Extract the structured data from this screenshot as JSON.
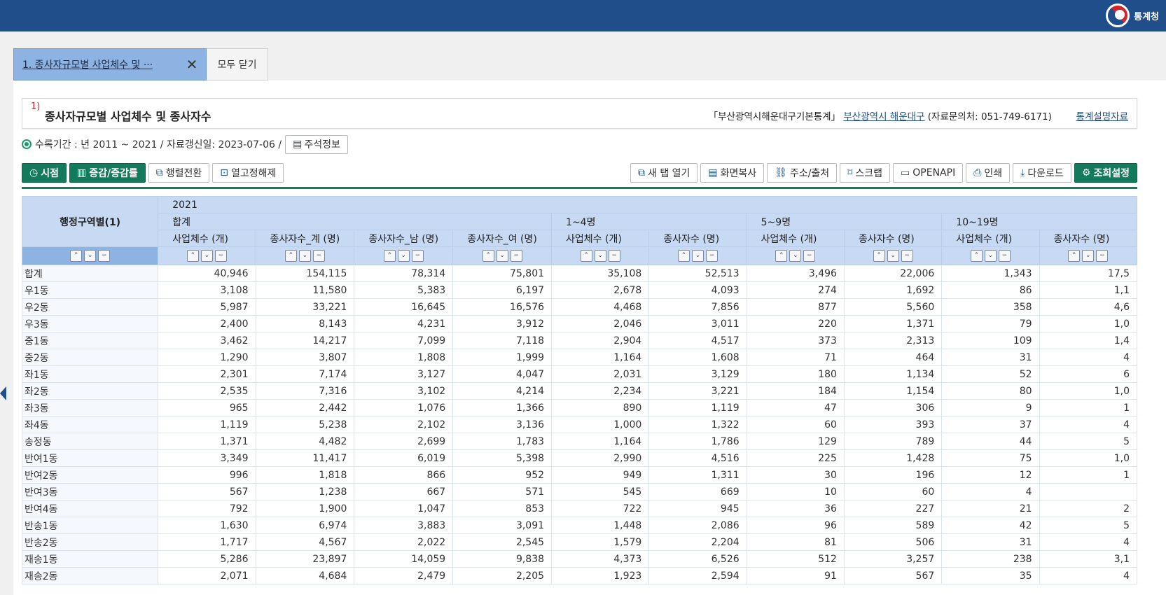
{
  "header": {
    "logo_text": "통계청",
    "colors": {
      "topbar": "#1f4e8a",
      "accent_green": "#137a5c",
      "tab_active": "#8db3e2"
    }
  },
  "tabs": {
    "active_label": "1. 종사자규모별 사업체수 및 ···",
    "close_icon": "close-icon",
    "close_all_label": "모두 닫기"
  },
  "title": {
    "footnote": "1)",
    "text": "종사자규모별 사업체수 및 종사자수",
    "source_label": "「부산광역시해운대구기본통계」",
    "agency_link": "부산광역시 해운대구",
    "contact": "(자료문의처: 051-749-6171)",
    "stat_info_link": "통계설명자료"
  },
  "info": {
    "text": "수록기간 : 년 2011 ~ 2021 / 자료갱신일: 2023-07-06 /",
    "note_button": "주석정보"
  },
  "toolbar": {
    "left": [
      {
        "label": "시점",
        "icon": "clock-icon",
        "glyph": "◷",
        "style": "green"
      },
      {
        "label": "증감/증감률",
        "icon": "bar-chart-icon",
        "glyph": "▥",
        "style": "green"
      },
      {
        "label": "행렬전환",
        "icon": "swap-icon",
        "glyph": "⧉",
        "style": "normal"
      },
      {
        "label": "열고정해제",
        "icon": "unlock-columns-icon",
        "glyph": "⊡",
        "style": "normal"
      }
    ],
    "right": [
      {
        "label": "새 탭 열기",
        "icon": "new-tab-icon",
        "glyph": "⧉",
        "style": "normal"
      },
      {
        "label": "화면복사",
        "icon": "copy-icon",
        "glyph": "▤",
        "style": "normal"
      },
      {
        "label": "주소/출처",
        "icon": "link-icon",
        "glyph": "⛓",
        "style": "normal"
      },
      {
        "label": "스크랩",
        "icon": "bookmark-icon",
        "glyph": "⌑",
        "style": "normal"
      },
      {
        "label": "OPENAPI",
        "icon": "api-icon",
        "glyph": "▭",
        "style": "normal"
      },
      {
        "label": "인쇄",
        "icon": "print-icon",
        "glyph": "⎙",
        "style": "normal"
      },
      {
        "label": "다운로드",
        "icon": "download-icon",
        "glyph": "⤓",
        "style": "normal"
      },
      {
        "label": "조회설정",
        "icon": "gear-icon",
        "glyph": "⚙",
        "style": "green"
      }
    ]
  },
  "table": {
    "row_header": "행정구역별(1)",
    "year": "2021",
    "groups": [
      {
        "label": "합계",
        "span": 4
      },
      {
        "label": "1~4명",
        "span": 2
      },
      {
        "label": "5~9명",
        "span": 2
      },
      {
        "label": "10~19명",
        "span": 2
      }
    ],
    "columns": [
      "사업체수 (개)",
      "종사자수_계 (명)",
      "종사자수_남 (명)",
      "종사자수_여 (명)",
      "사업체수 (개)",
      "종사자수 (명)",
      "사업체수 (개)",
      "종사자수 (명)",
      "사업체수 (개)",
      "종사자수 (명)"
    ],
    "rows": [
      {
        "name": "합계",
        "values": [
          "40,946",
          "154,115",
          "78,314",
          "75,801",
          "35,108",
          "52,513",
          "3,496",
          "22,006",
          "1,343",
          "17,5"
        ]
      },
      {
        "name": "우1동",
        "values": [
          "3,108",
          "11,580",
          "5,383",
          "6,197",
          "2,678",
          "4,093",
          "274",
          "1,692",
          "86",
          "1,1"
        ]
      },
      {
        "name": "우2동",
        "values": [
          "5,987",
          "33,221",
          "16,645",
          "16,576",
          "4,468",
          "7,856",
          "877",
          "5,560",
          "358",
          "4,6"
        ]
      },
      {
        "name": "우3동",
        "values": [
          "2,400",
          "8,143",
          "4,231",
          "3,912",
          "2,046",
          "3,011",
          "220",
          "1,371",
          "79",
          "1,0"
        ]
      },
      {
        "name": "중1동",
        "values": [
          "3,462",
          "14,217",
          "7,099",
          "7,118",
          "2,904",
          "4,517",
          "373",
          "2,313",
          "109",
          "1,4"
        ]
      },
      {
        "name": "중2동",
        "values": [
          "1,290",
          "3,807",
          "1,808",
          "1,999",
          "1,164",
          "1,608",
          "71",
          "464",
          "31",
          "4"
        ]
      },
      {
        "name": "좌1동",
        "values": [
          "2,301",
          "7,174",
          "3,127",
          "4,047",
          "2,031",
          "3,129",
          "180",
          "1,134",
          "52",
          "6"
        ]
      },
      {
        "name": "좌2동",
        "values": [
          "2,535",
          "7,316",
          "3,102",
          "4,214",
          "2,234",
          "3,221",
          "184",
          "1,154",
          "80",
          "1,0"
        ]
      },
      {
        "name": "좌3동",
        "values": [
          "965",
          "2,442",
          "1,076",
          "1,366",
          "890",
          "1,119",
          "47",
          "306",
          "9",
          "1"
        ]
      },
      {
        "name": "좌4동",
        "values": [
          "1,119",
          "5,238",
          "2,102",
          "3,136",
          "1,000",
          "1,322",
          "60",
          "393",
          "37",
          "4"
        ]
      },
      {
        "name": "송정동",
        "values": [
          "1,371",
          "4,482",
          "2,699",
          "1,783",
          "1,164",
          "1,786",
          "129",
          "789",
          "44",
          "5"
        ]
      },
      {
        "name": "반여1동",
        "values": [
          "3,349",
          "11,417",
          "6,019",
          "5,398",
          "2,990",
          "4,516",
          "225",
          "1,428",
          "75",
          "1,0"
        ]
      },
      {
        "name": "반여2동",
        "values": [
          "996",
          "1,818",
          "866",
          "952",
          "949",
          "1,311",
          "30",
          "196",
          "12",
          "1"
        ]
      },
      {
        "name": "반여3동",
        "values": [
          "567",
          "1,238",
          "667",
          "571",
          "545",
          "669",
          "10",
          "60",
          "4",
          ""
        ]
      },
      {
        "name": "반여4동",
        "values": [
          "792",
          "1,900",
          "1,047",
          "853",
          "722",
          "945",
          "36",
          "227",
          "21",
          "2"
        ]
      },
      {
        "name": "반송1동",
        "values": [
          "1,630",
          "6,974",
          "3,883",
          "3,091",
          "1,448",
          "2,086",
          "96",
          "589",
          "42",
          "5"
        ]
      },
      {
        "name": "반송2동",
        "values": [
          "1,717",
          "4,567",
          "2,022",
          "2,545",
          "1,579",
          "2,204",
          "81",
          "506",
          "31",
          "4"
        ]
      },
      {
        "name": "재송1동",
        "values": [
          "5,286",
          "23,897",
          "14,059",
          "9,838",
          "4,373",
          "6,526",
          "512",
          "3,257",
          "238",
          "3,1"
        ]
      },
      {
        "name": "재송2동",
        "values": [
          "2,071",
          "4,684",
          "2,479",
          "2,205",
          "1,923",
          "2,594",
          "91",
          "567",
          "35",
          "4"
        ]
      }
    ]
  }
}
